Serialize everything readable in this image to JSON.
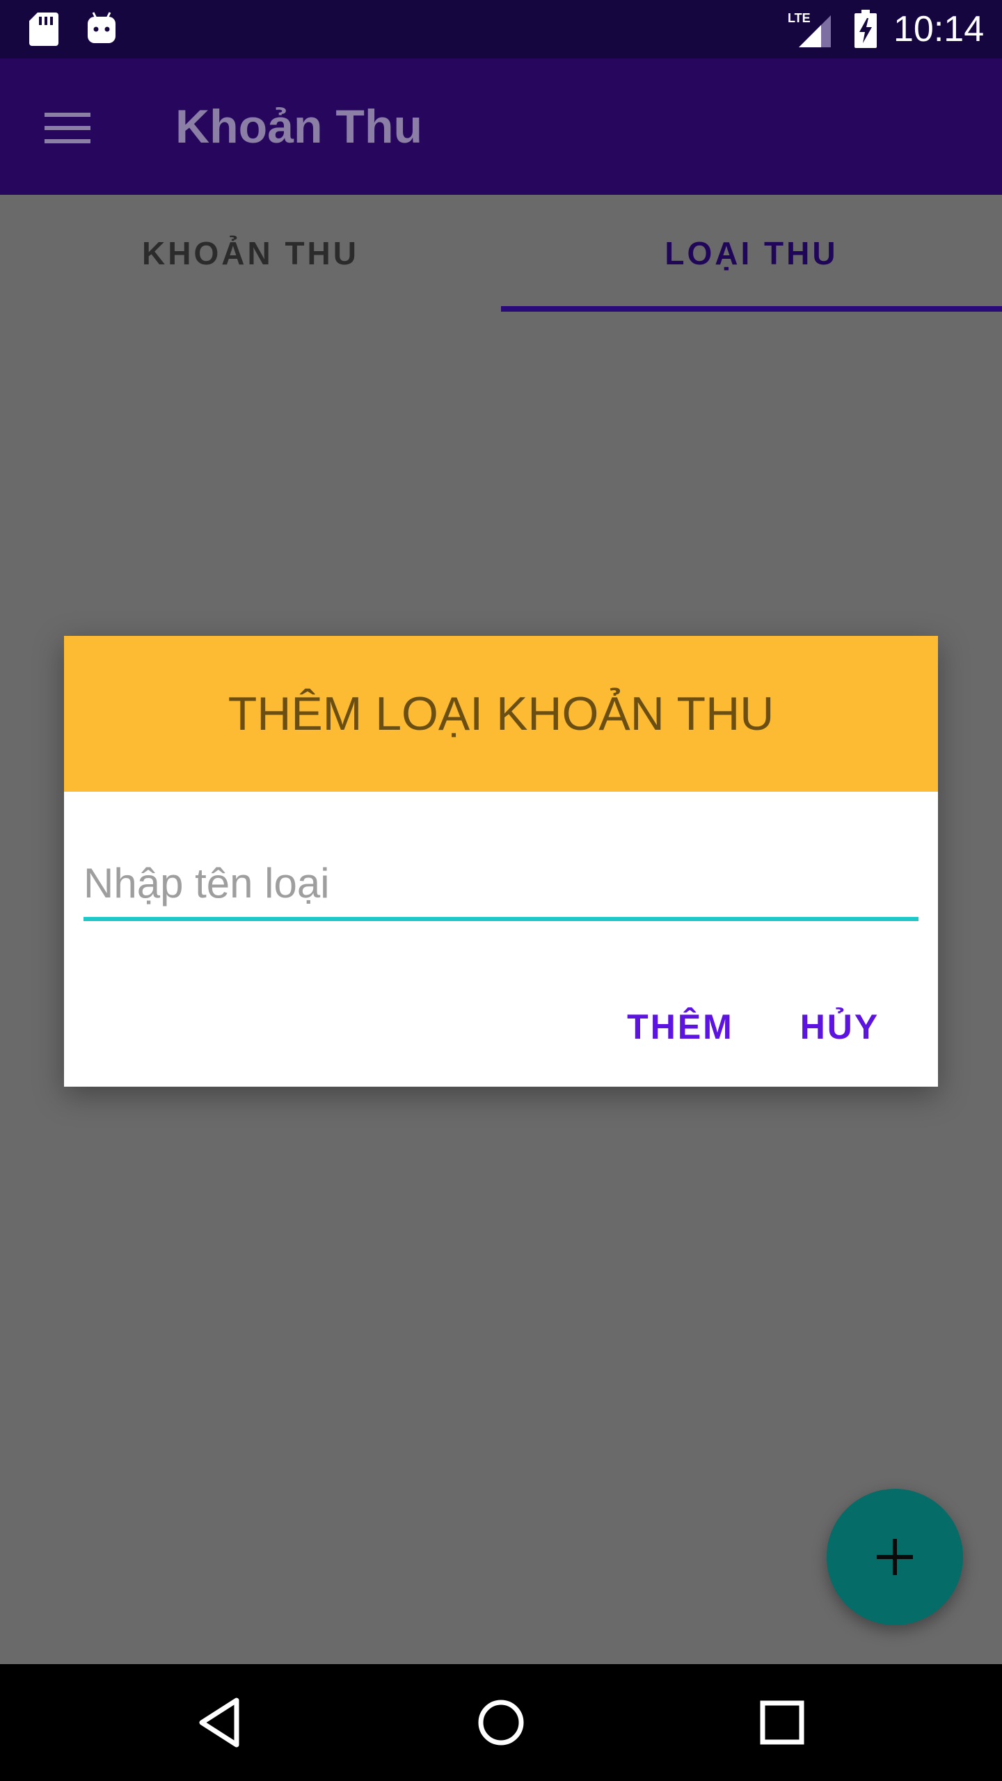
{
  "status_bar": {
    "time": "10:14",
    "network": "LTE",
    "icons": [
      "sd-card-icon",
      "android-icon",
      "lte-signal-icon",
      "battery-charging-icon"
    ]
  },
  "app_bar": {
    "title": "Khoản Thu",
    "menu_icon": "hamburger-menu-icon"
  },
  "tabs": [
    {
      "label": "KHOẢN THU",
      "selected": false
    },
    {
      "label": "LOẠI THU",
      "selected": true
    }
  ],
  "dialog": {
    "title": "THÊM LOẠI KHOẢN THU",
    "input": {
      "value": "",
      "placeholder": "Nhập tên loại"
    },
    "buttons": {
      "add": "THÊM",
      "cancel": "HỦY"
    }
  },
  "fab": {
    "icon": "plus-icon"
  },
  "nav_bar": {
    "icons": [
      "back-triangle-icon",
      "home-circle-icon",
      "recents-square-icon"
    ]
  },
  "colors": {
    "status_bar": "#160640",
    "app_bar": "#27065e",
    "scrim_background": "#6a6a6a",
    "dialog_header": "#fdbb34",
    "dialog_title_text": "#6a4e12",
    "accent_button_text": "#5d14e0",
    "input_underline": "#1fc8c8",
    "fab": "#056c68",
    "tab_indicator": "#2a0a78"
  }
}
